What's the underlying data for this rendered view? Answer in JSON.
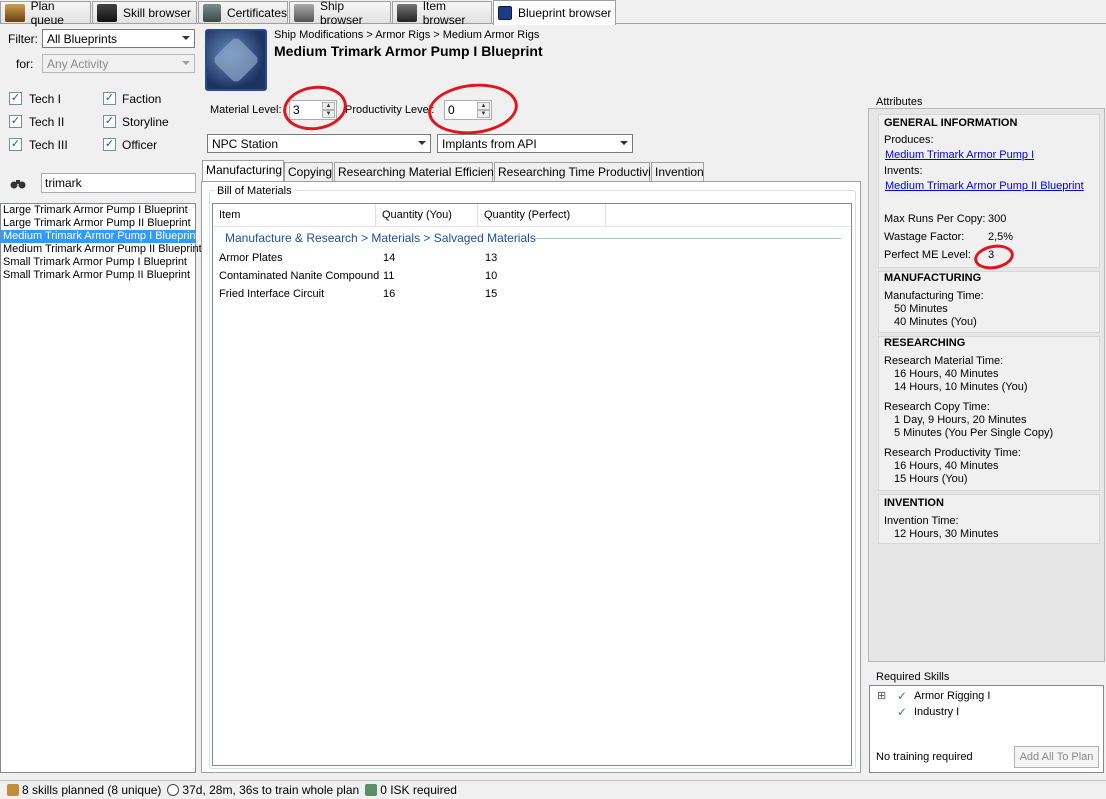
{
  "tabs": [
    {
      "label": "Plan queue",
      "icon": "plan-queue-icon"
    },
    {
      "label": "Skill browser",
      "icon": "skill-browser-icon"
    },
    {
      "label": "Certificates",
      "icon": "certificates-icon"
    },
    {
      "label": "Ship browser",
      "icon": "ship-browser-icon"
    },
    {
      "label": "Item browser",
      "icon": "item-browser-icon"
    },
    {
      "label": "Blueprint browser",
      "icon": "blueprint-browser-icon"
    }
  ],
  "left": {
    "filter_label": "Filter:",
    "filter_value": "All Blueprints",
    "for_label": "for:",
    "activity_value": "Any Activity",
    "checkboxes": [
      {
        "label": "Tech I",
        "checked": true
      },
      {
        "label": "Faction",
        "checked": true
      },
      {
        "label": "Tech II",
        "checked": true
      },
      {
        "label": "Storyline",
        "checked": true
      },
      {
        "label": "Tech III",
        "checked": true
      },
      {
        "label": "Officer",
        "checked": true
      }
    ],
    "check_mark": "✓",
    "search_value": "trimark",
    "blueprints": [
      "Large Trimark Armor Pump I Blueprint",
      "Large Trimark Armor Pump II Blueprint",
      "Medium Trimark Armor Pump I Blueprint",
      "Medium Trimark Armor Pump II Blueprint",
      "Small Trimark Armor Pump I Blueprint",
      "Small Trimark Armor Pump II Blueprint"
    ],
    "selected_index": 2
  },
  "header": {
    "breadcrumb": "Ship Modifications > Armor Rigs > Medium Armor Rigs",
    "title": "Medium Trimark Armor Pump I Blueprint",
    "material_level_label": "Material Level:",
    "material_level_value": "3",
    "productivity_level_label": "Productivity Level:",
    "productivity_level_value": "0",
    "station_value": "NPC Station",
    "implants_value": "Implants from API"
  },
  "subtabs": [
    "Manufacturing",
    "Copying",
    "Researching Material Efficiency",
    "Researching Time Productivity",
    "Invention"
  ],
  "bom": {
    "group_title": "Bill of Materials",
    "columns": [
      "Item",
      "Quantity (You)",
      "Quantity (Perfect)"
    ],
    "category": "Manufacture & Research > Materials > Salvaged Materials",
    "rows": [
      {
        "item": "Armor Plates",
        "you": "14",
        "perfect": "13"
      },
      {
        "item": "Contaminated Nanite Compound",
        "you": "11",
        "perfect": "10"
      },
      {
        "item": "Fried Interface Circuit",
        "you": "16",
        "perfect": "15"
      }
    ]
  },
  "attributes": {
    "title": "Attributes",
    "general": {
      "heading": "GENERAL INFORMATION",
      "produces_label": "Produces:",
      "produces_link": "Medium Trimark Armor Pump I",
      "invents_label": "Invents:",
      "invents_link": "Medium Trimark Armor Pump II Blueprint",
      "max_runs_label": "Max Runs Per Copy:",
      "max_runs_value": "300",
      "wastage_label": "Wastage Factor:",
      "wastage_value": "2,5%",
      "perfect_me_label": "Perfect ME Level:",
      "perfect_me_value": "3"
    },
    "manufacturing": {
      "heading": "MANUFACTURING",
      "time_label": "Manufacturing Time:",
      "time_base": "50 Minutes",
      "time_you": "40 Minutes (You)"
    },
    "researching": {
      "heading": "RESEARCHING",
      "rm_label": "Research Material Time:",
      "rm_base": "16 Hours, 40 Minutes",
      "rm_you": "14 Hours, 10 Minutes (You)",
      "rc_label": "Research Copy Time:",
      "rc_base": "1 Day, 9 Hours, 20 Minutes",
      "rc_you": "5 Minutes (You Per Single Copy)",
      "rp_label": "Research Productivity Time:",
      "rp_base": "16 Hours, 40 Minutes",
      "rp_you": "15 Hours (You)"
    },
    "invention": {
      "heading": "INVENTION",
      "time_label": "Invention Time:",
      "time_value": "12 Hours, 30 Minutes"
    }
  },
  "required_skills": {
    "title": "Required Skills",
    "skills": [
      "Armor Rigging I",
      "Industry I"
    ],
    "expander": "⊞",
    "check_mark": "✓",
    "status": "No training required",
    "add_button": "Add All To Plan"
  },
  "status": {
    "skills": "8 skills planned (8 unique)",
    "time": "37d, 28m, 36s to train whole plan",
    "isk": "0 ISK required"
  },
  "colors": {
    "selection": "#3399ff",
    "annotation_red": "#e0161e",
    "link": "#0000ee",
    "category_text": "#1f4e9c",
    "check_green": "#2e9e2e"
  }
}
